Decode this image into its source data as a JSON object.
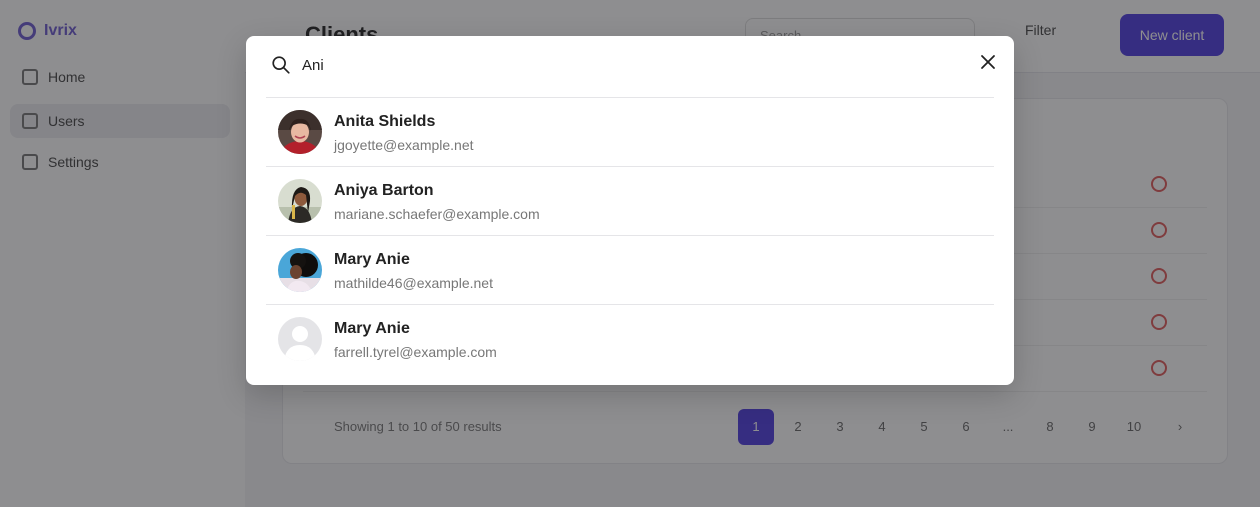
{
  "background": {
    "logo_text": "Ivrix",
    "nav": [
      "Home",
      "Users",
      "Settings"
    ],
    "page_title": "Clients",
    "search_placeholder": "Search…",
    "filter_label": "Filter",
    "new_button_label": "New client",
    "pagination_info": "Showing 1 to 10 of 50 results",
    "pages": [
      "1",
      "2",
      "3",
      "4",
      "5",
      "6",
      "...",
      "8",
      "9",
      "10",
      "›"
    ]
  },
  "modal": {
    "search_value": "Ani",
    "results": [
      {
        "name": "Anita Shields",
        "email": "jgoyette@example.net",
        "avatar": "photo"
      },
      {
        "name": "Aniya Barton",
        "email": "mariane.schaefer@example.com",
        "avatar": "photo"
      },
      {
        "name": "Mary Anie",
        "email": "mathilde46@example.net",
        "avatar": "photo"
      },
      {
        "name": "Mary Anie",
        "email": "farrell.tyrel@example.com",
        "avatar": "placeholder"
      }
    ]
  },
  "icons": {
    "search": "search-icon",
    "close": "close-icon"
  },
  "colors": {
    "accent": "#4f3de0",
    "danger": "#e05a5a",
    "overlay": "rgba(30,30,34,0.5)"
  }
}
